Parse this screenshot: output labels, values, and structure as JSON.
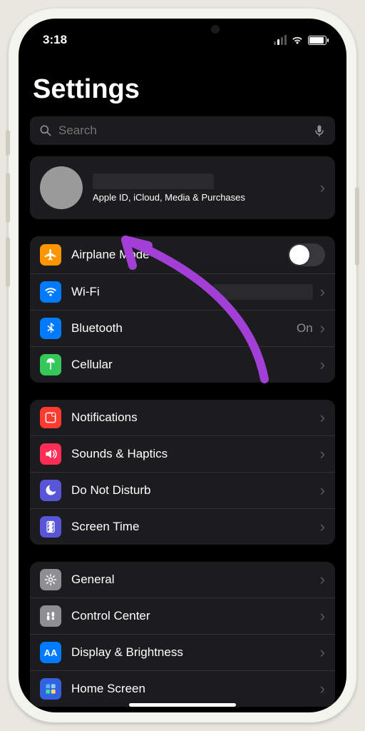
{
  "status": {
    "time": "3:18"
  },
  "title": "Settings",
  "search": {
    "placeholder": "Search"
  },
  "profile": {
    "subtitle": "Apple ID, iCloud, Media & Purchases"
  },
  "groups": [
    {
      "rows": [
        {
          "icon": "airplane",
          "color": "#ff9500",
          "label": "Airplane Mode",
          "control": "toggle",
          "toggled": false
        },
        {
          "icon": "wifi",
          "color": "#007aff",
          "label": "Wi-Fi",
          "control": "redacted-chevron"
        },
        {
          "icon": "bluetooth",
          "color": "#007aff",
          "label": "Bluetooth",
          "control": "value-chevron",
          "value": "On"
        },
        {
          "icon": "cellular",
          "color": "#34c759",
          "label": "Cellular",
          "control": "chevron"
        }
      ]
    },
    {
      "rows": [
        {
          "icon": "notifications",
          "color": "#ff3b30",
          "label": "Notifications",
          "control": "chevron"
        },
        {
          "icon": "sounds",
          "color": "#ff2d55",
          "label": "Sounds & Haptics",
          "control": "chevron"
        },
        {
          "icon": "dnd",
          "color": "#5856d6",
          "label": "Do Not Disturb",
          "control": "chevron"
        },
        {
          "icon": "screentime",
          "color": "#5856d6",
          "label": "Screen Time",
          "control": "chevron"
        }
      ]
    },
    {
      "rows": [
        {
          "icon": "general",
          "color": "#8e8e93",
          "label": "General",
          "control": "chevron"
        },
        {
          "icon": "controlcenter",
          "color": "#8e8e93",
          "label": "Control Center",
          "control": "chevron"
        },
        {
          "icon": "display",
          "color": "#007aff",
          "label": "Display & Brightness",
          "control": "chevron",
          "textIcon": "AA"
        },
        {
          "icon": "homescreen",
          "color": "#3361df",
          "label": "Home Screen",
          "control": "chevron"
        }
      ]
    }
  ]
}
